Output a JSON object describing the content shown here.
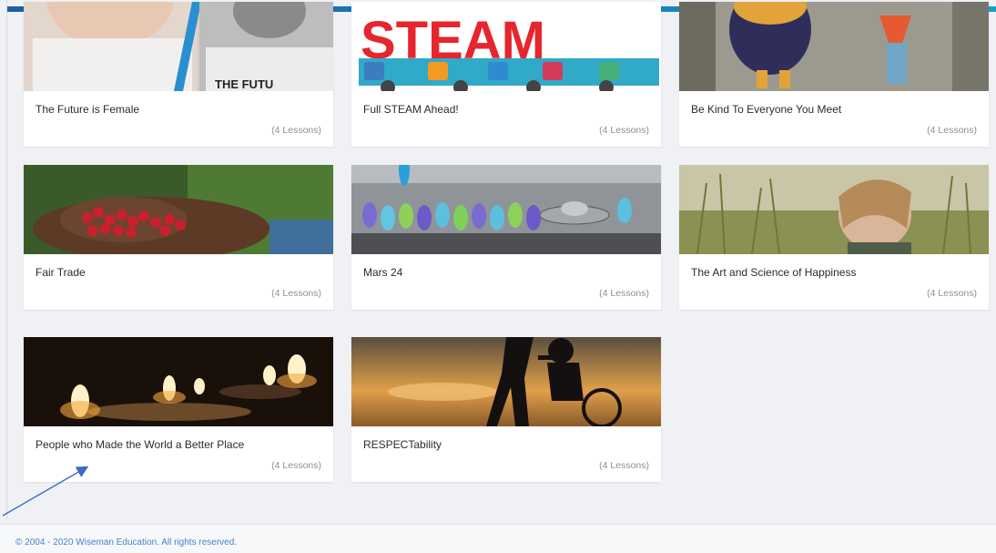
{
  "courses": [
    {
      "title": "The Future is Female",
      "lessons": "(4 Lessons)"
    },
    {
      "title": "Full STEAM Ahead!",
      "lessons": "(4 Lessons)",
      "thumb_text": "STEAM"
    },
    {
      "title": "Be Kind To Everyone You Meet",
      "lessons": "(4 Lessons)"
    },
    {
      "title": "Fair Trade",
      "lessons": "(4 Lessons)"
    },
    {
      "title": "Mars 24",
      "lessons": "(4 Lessons)"
    },
    {
      "title": "The Art and Science of Happiness",
      "lessons": "(4 Lessons)"
    },
    {
      "title": "People who Made the World a Better Place",
      "lessons": "(4 Lessons)"
    },
    {
      "title": "RESPECTability",
      "lessons": "(4 Lessons)"
    }
  ],
  "footer": {
    "copyright": "© 2004 - 2020 Wiseman Education. All rights reserved."
  },
  "colors": {
    "accent_bar": "#1e78b8",
    "link": "#3f86c8",
    "annotation_arrow": "#3b6cc9"
  }
}
